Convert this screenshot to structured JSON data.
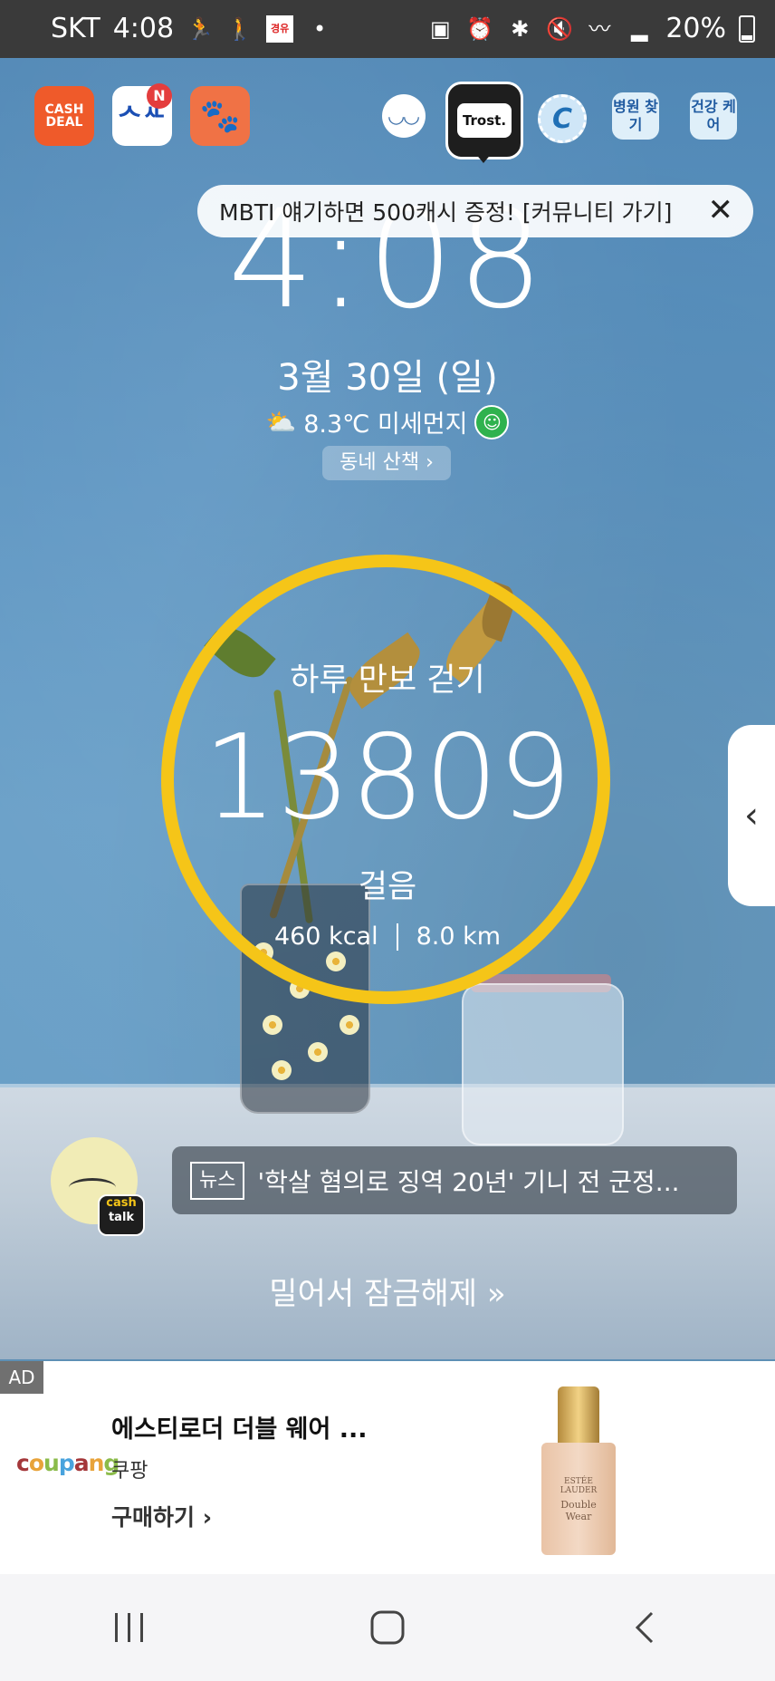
{
  "status_bar": {
    "carrier": "SKT",
    "time": "4:08",
    "battery": "20%",
    "notification_badge": "경유"
  },
  "top_apps": {
    "cash_deal": "CASH DEAL",
    "n_badge": "N",
    "trost": "Trost.",
    "hospital": "병원 찾기",
    "health_care": "건강 케어"
  },
  "promo": {
    "text": "MBTI 얘기하면 500캐시 증정! [커뮤니티 가기]",
    "close_icon": "close-icon"
  },
  "clock": {
    "time": "4:08",
    "date": "3월 30일 (일)",
    "weather": "8.3℃ 미세먼지",
    "walk_button": "동네 산책 ›"
  },
  "steps": {
    "title": "하루 만보 걷기",
    "count": "13809",
    "unit": "걸음",
    "kcal": "460 kcal",
    "distance": "8.0 km"
  },
  "news": {
    "tag": "뉴스",
    "headline": "'학살 혐의로 징역 20년' 기니 전 군정...",
    "cash_talk_1": "cash",
    "cash_talk_2": "talk"
  },
  "unlock": {
    "text": "밀어서 잠금해제 »"
  },
  "ad": {
    "label": "AD",
    "logo": "coupang",
    "title": "에스티로더 더블 웨어 ...",
    "brand": "쿠팡",
    "buy": "구매하기 ›",
    "bottle_brand": "ESTÉE LAUDER",
    "bottle_name": "Double Wear"
  },
  "colors": {
    "ring": "#f5c518",
    "background": "#5d8fb5"
  }
}
